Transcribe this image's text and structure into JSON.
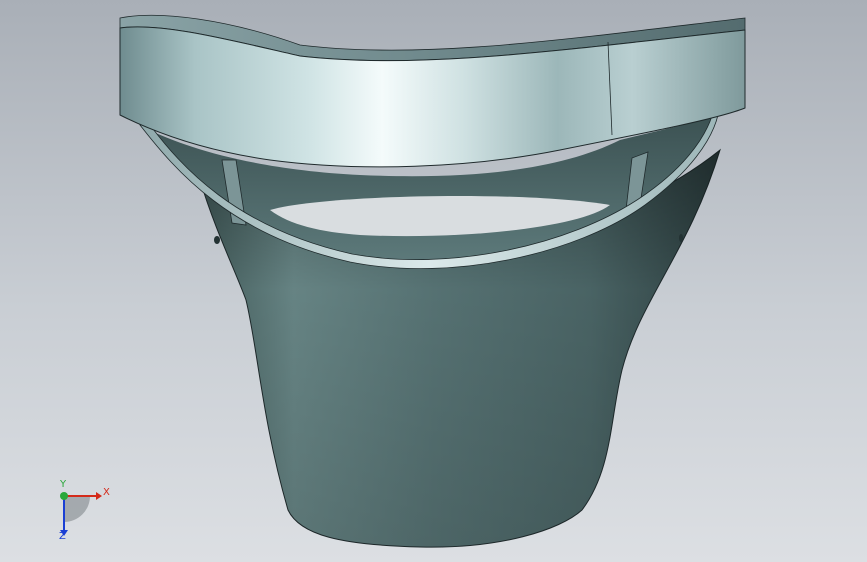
{
  "viewport": {
    "background_top": "#a9afb7",
    "background_bottom": "#dcdfe3"
  },
  "model": {
    "body_color": "#5a7576",
    "rim_color": "#9ab4b6",
    "highlight_color": "#eef6f7",
    "edge_color": "#1f2a2c"
  },
  "triad": {
    "x_label": "X",
    "y_label": "Y",
    "z_label": "Z",
    "x_color": "#d42a1a",
    "y_color": "#2aa83a",
    "z_color": "#1a3fd4"
  }
}
